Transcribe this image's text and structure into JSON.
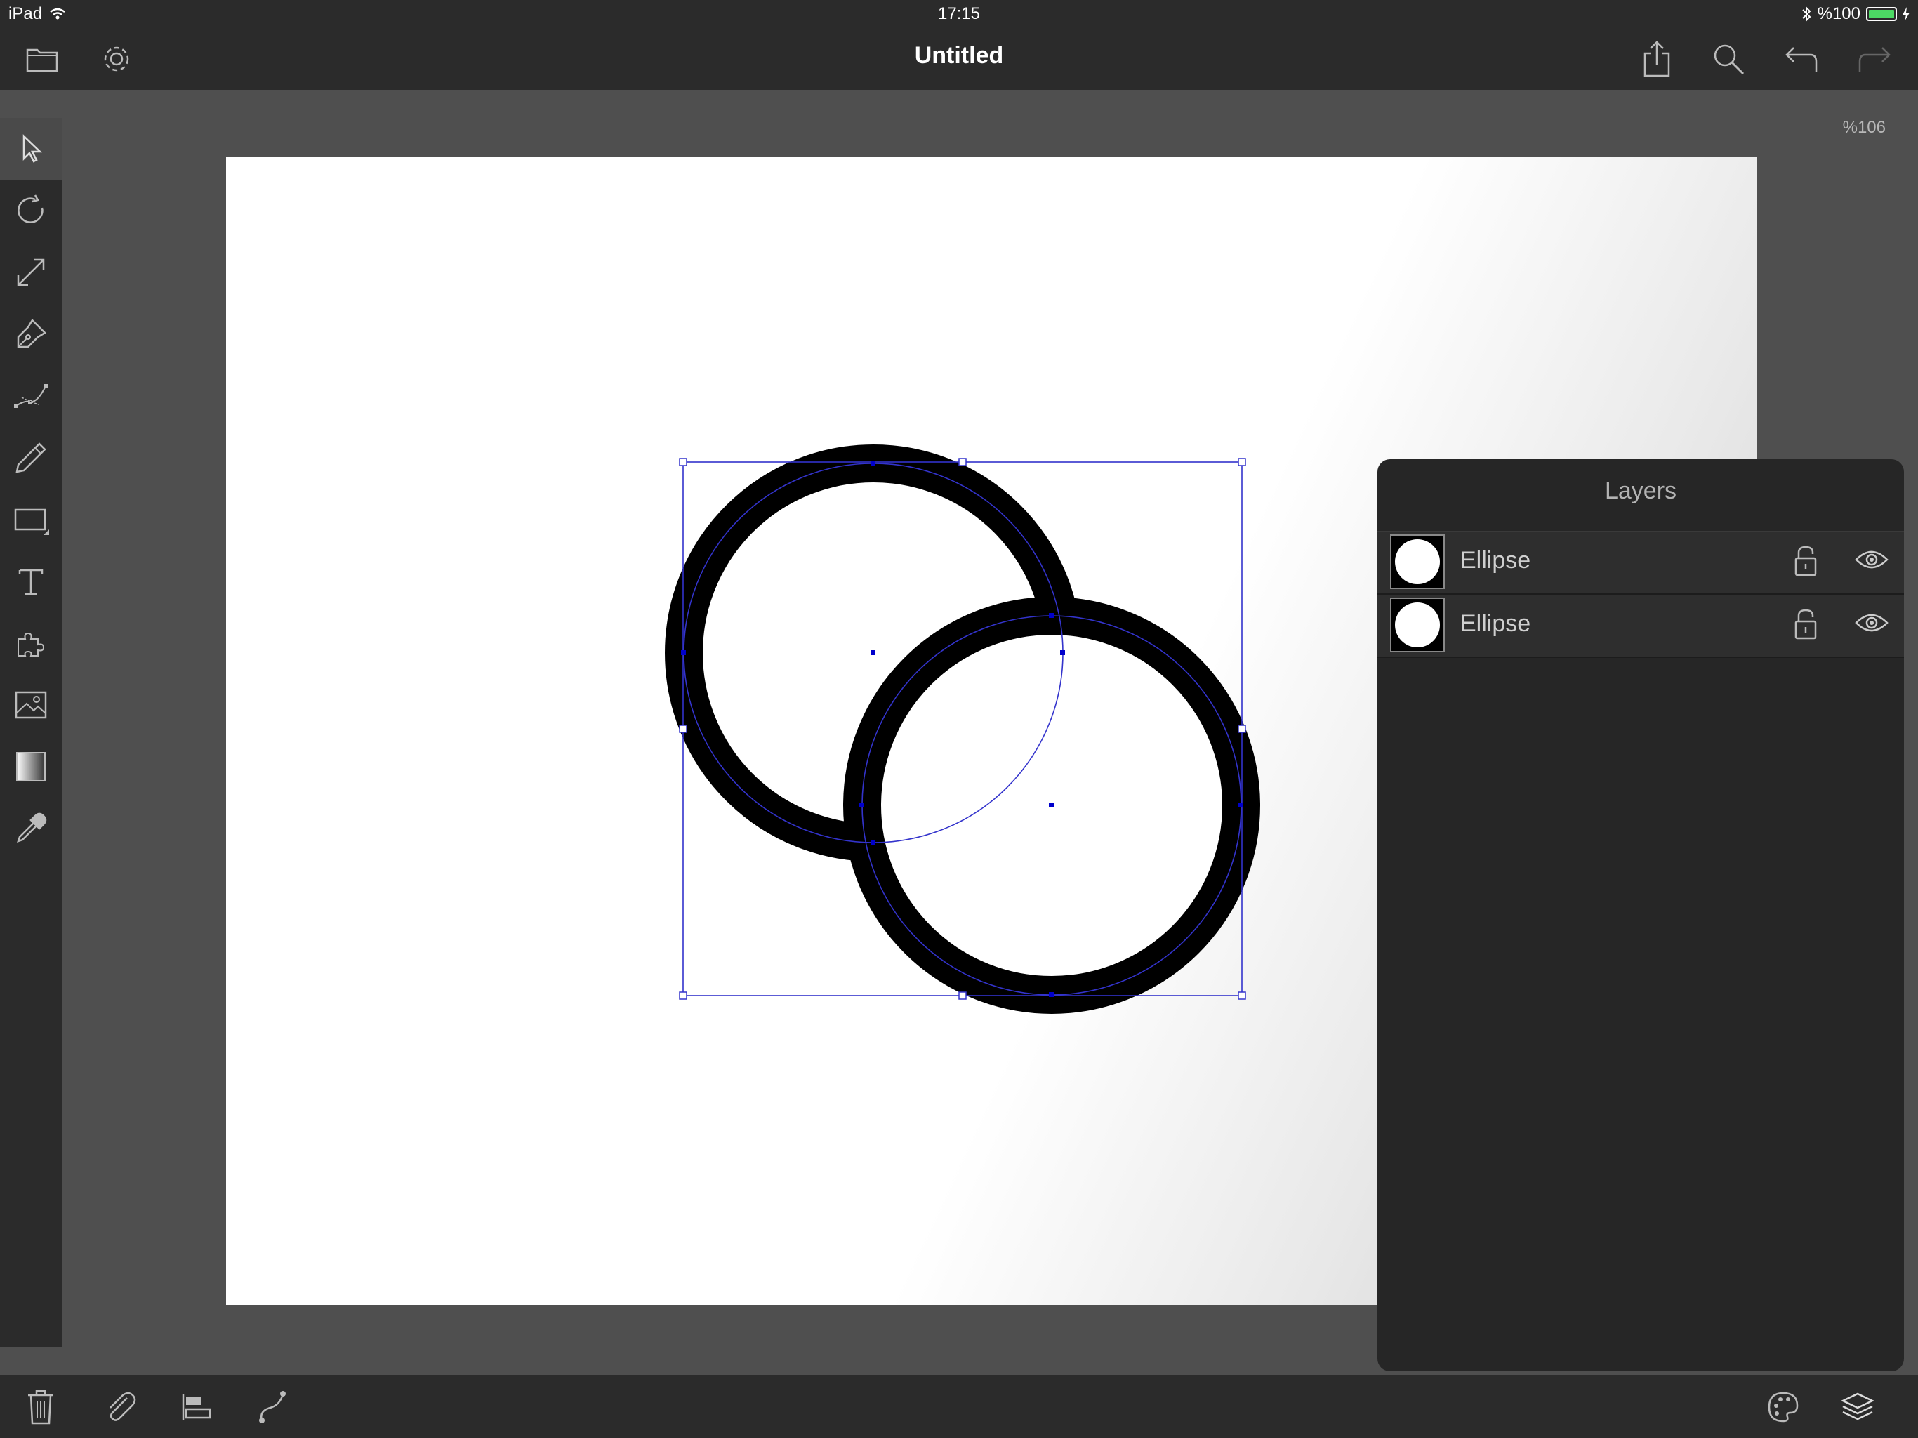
{
  "status": {
    "device": "iPad",
    "time": "17:15",
    "battery": "%100"
  },
  "toolbar": {
    "title": "Untitled",
    "icons": [
      "folder-icon",
      "gear-icon",
      "share-icon",
      "search-icon",
      "undo-icon",
      "redo-icon"
    ]
  },
  "tools": [
    "select-arrow-icon",
    "rotate-icon",
    "scale-icon",
    "pen-icon",
    "node-edit-icon",
    "pencil-icon",
    "rectangle-icon",
    "text-icon",
    "puzzle-icon",
    "image-icon",
    "gradient-icon",
    "eyedropper-icon"
  ],
  "zoom": "%106",
  "layers": {
    "title": "Layers",
    "items": [
      {
        "name": "Ellipse"
      },
      {
        "name": "Ellipse"
      }
    ]
  },
  "bottom": {
    "icons": [
      "trash-icon",
      "paperclip-icon",
      "align-icon",
      "path-icon",
      "palette-icon",
      "layers-icon"
    ]
  },
  "colors": {
    "chrome": "#2b2b2b",
    "workspace": "#4f4f4f",
    "selection": "#3333cc",
    "stroke": "#000000"
  }
}
